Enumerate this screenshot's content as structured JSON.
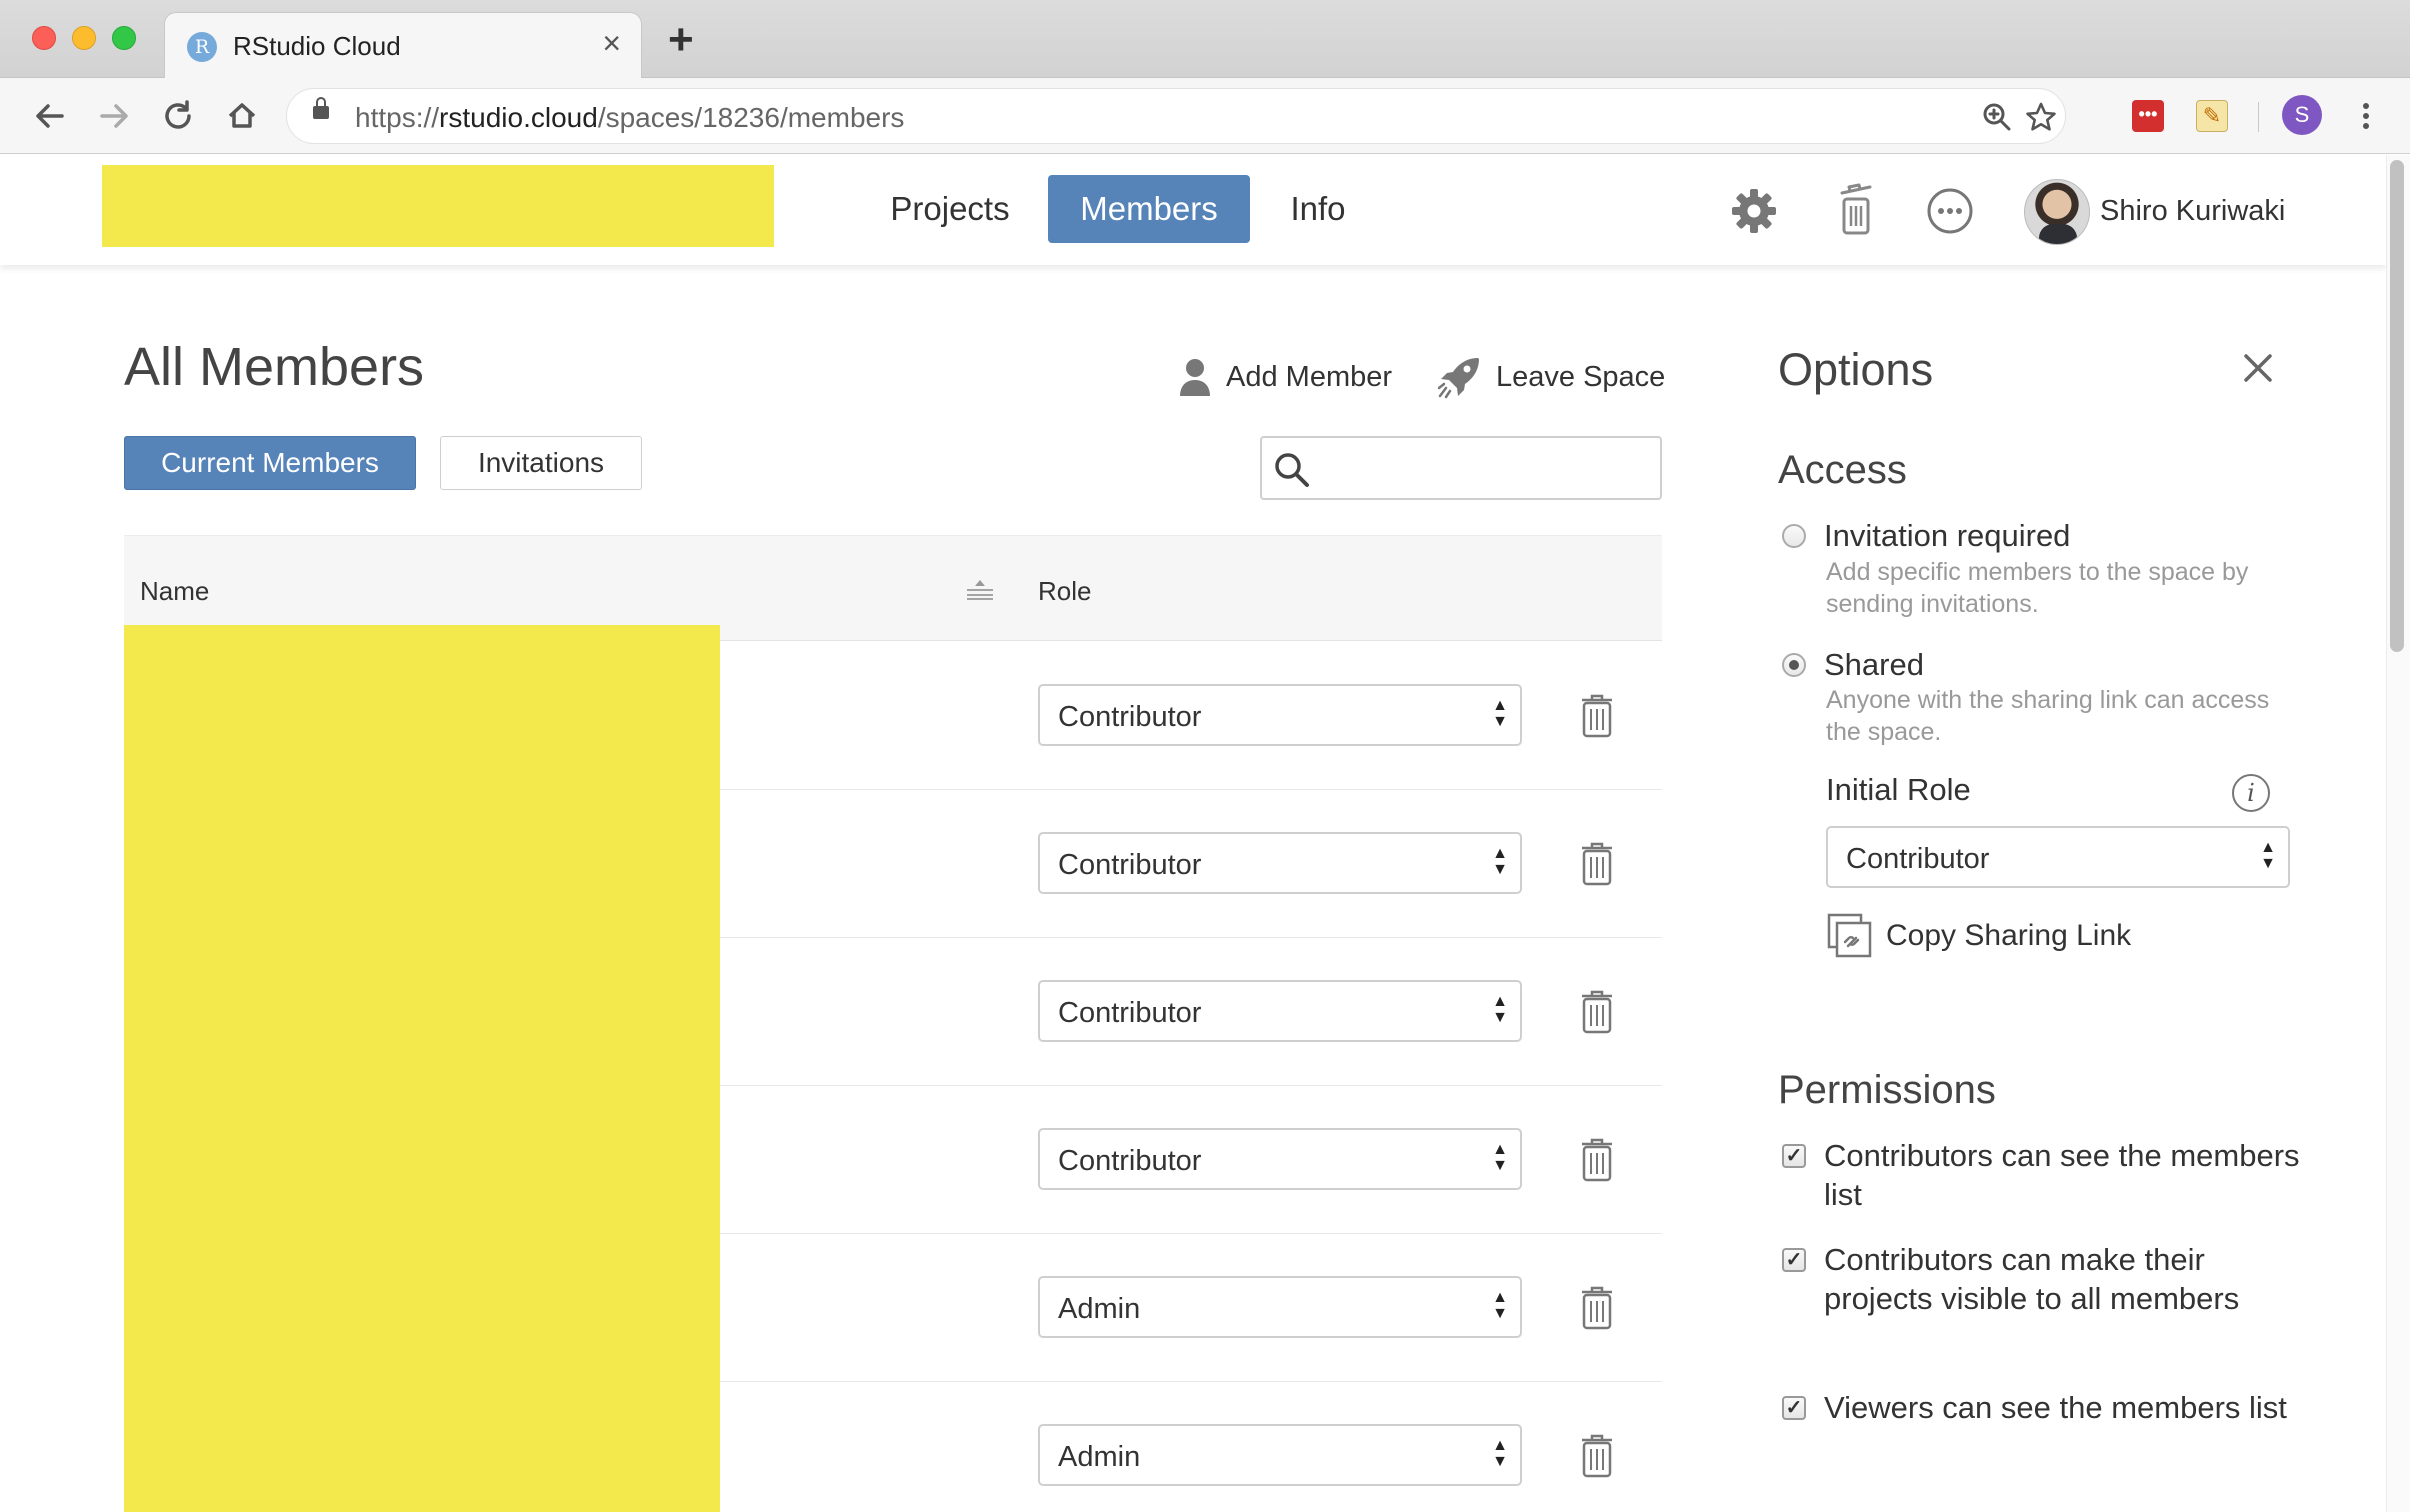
{
  "browser": {
    "tab_title": "RStudio Cloud",
    "tab_favicon_letter": "R",
    "tab_close": "×",
    "new_tab": "+",
    "url_scheme": "https://",
    "url_host": "rstudio.cloud",
    "url_path": "/spaces/18236/members",
    "profile_initial": "S",
    "icons": [
      "back-icon",
      "forward-icon",
      "reload-icon",
      "home-icon",
      "lock-icon",
      "zoom-icon",
      "star-icon",
      "extension-icon",
      "notepad-extension-icon",
      "profile-icon",
      "menu-icon"
    ]
  },
  "header": {
    "nav": [
      {
        "label": "Projects",
        "active": false
      },
      {
        "label": "Members",
        "active": true
      },
      {
        "label": "Info",
        "active": false
      }
    ],
    "icons": [
      "gear-icon",
      "trash-icon",
      "more-icon"
    ],
    "user_name": "Shiro Kuriwaki"
  },
  "main": {
    "title": "All Members",
    "actions": {
      "add_member": "Add Member",
      "leave_space": "Leave Space"
    },
    "tabs": {
      "current": "Current Members",
      "invitations": "Invitations"
    },
    "search_placeholder": "",
    "table": {
      "headers": {
        "name": "Name",
        "role": "Role"
      },
      "rows": [
        {
          "role": "Contributor"
        },
        {
          "role": "Contributor"
        },
        {
          "role": "Contributor"
        },
        {
          "role": "Contributor"
        },
        {
          "role": "Admin"
        },
        {
          "role": "Admin"
        }
      ]
    }
  },
  "options": {
    "title": "Options",
    "access": {
      "title": "Access",
      "invitation_label": "Invitation required",
      "invitation_desc": "Add specific members to the space by sending invitations.",
      "invitation_selected": false,
      "shared_label": "Shared",
      "shared_desc": "Anyone with the sharing link can access the space.",
      "shared_selected": true,
      "initial_role_label": "Initial Role",
      "initial_role_value": "Contributor",
      "copy_link": "Copy Sharing Link"
    },
    "permissions": {
      "title": "Permissions",
      "items": [
        {
          "label": "Contributors can see the members list",
          "checked": true
        },
        {
          "label": "Contributors can make their projects visible to all members",
          "checked": true
        },
        {
          "label": "Viewers can see the members list",
          "checked": true
        }
      ]
    }
  },
  "colors": {
    "accent": "#5683b8",
    "redaction": "#f4e94c"
  }
}
